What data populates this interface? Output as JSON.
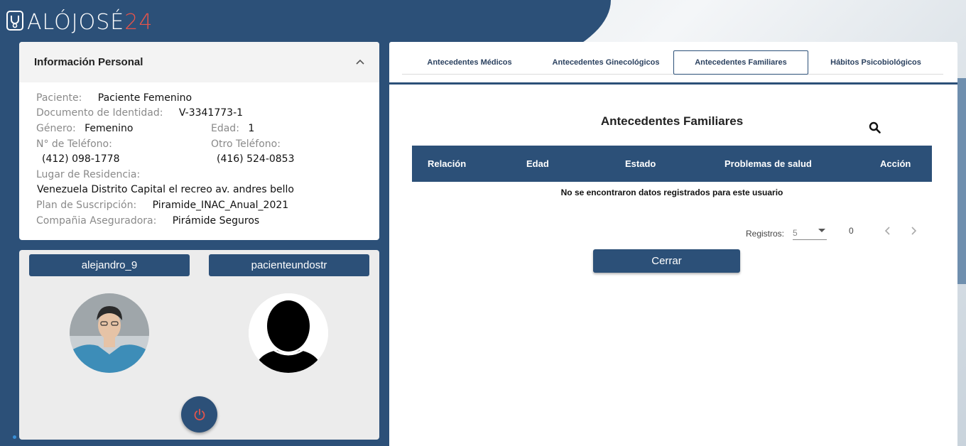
{
  "logo": {
    "text_main": "ALÓJOSÉ",
    "text_accent": "24"
  },
  "personal_info": {
    "title": "Información Personal",
    "paciente_label": "Paciente:",
    "paciente_value": "Paciente Femenino",
    "documento_label": "Documento de Identidad:",
    "documento_value": "V-3341773-1",
    "genero_label": "Género:",
    "genero_value": "Femenino",
    "edad_label": "Edad:",
    "edad_value": "1",
    "telefono_label": "N° de Teléfono:",
    "telefono_value": "(412) 098-1778",
    "otro_telefono_label": "Otro Teléfono:",
    "otro_telefono_value": "(416) 524-0853",
    "residencia_label": "Lugar de Residencia:",
    "residencia_value": "Venezuela Distrito Capital el recreo av. andres bello",
    "plan_label": "Plan de Suscripción:",
    "plan_value": "Piramide_INAC_Anual_2021",
    "aseguradora_label": "Compañia Aseguradora:",
    "aseguradora_value": "Pirámide Seguros"
  },
  "users": [
    {
      "name": "alejandro_9",
      "avatar": "doctor-photo"
    },
    {
      "name": "pacienteundostr",
      "avatar": "default-silhouette"
    }
  ],
  "tabs": [
    {
      "label": "Antecedentes Médicos",
      "active": false
    },
    {
      "label": "Antecedentes Ginecológicos",
      "active": false
    },
    {
      "label": "Antecedentes Familiares",
      "active": true
    },
    {
      "label": "Hábitos Psicobiológicos",
      "active": false
    }
  ],
  "section": {
    "title": "Antecedentes Familiares",
    "columns": [
      "Relación",
      "Edad",
      "Estado",
      "Problemas de salud",
      "Acción"
    ],
    "empty_message": "No se encontraron datos registrados para este usuario"
  },
  "pagination": {
    "label": "Registros:",
    "page_size": "5",
    "count": "0"
  },
  "actions": {
    "close_label": "Cerrar"
  },
  "colors": {
    "primary": "#2c5078",
    "accent": "#e5544b",
    "panel_gray": "#ececec"
  }
}
